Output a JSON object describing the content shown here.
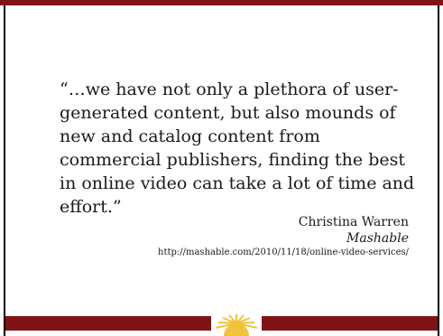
{
  "slide": {
    "quote": "“…we have not only a plethora of user-generated content, but also mounds of new and catalog content from commercial publishers, finding the best in online video can take a lot of time and effort.”",
    "author": "Christina Warren",
    "source": "Mashable",
    "url": "http://mashable.com/2010/11/18/online-video-services/"
  },
  "colors": {
    "accent": "#7f1416",
    "logo": "#f2c23a"
  }
}
